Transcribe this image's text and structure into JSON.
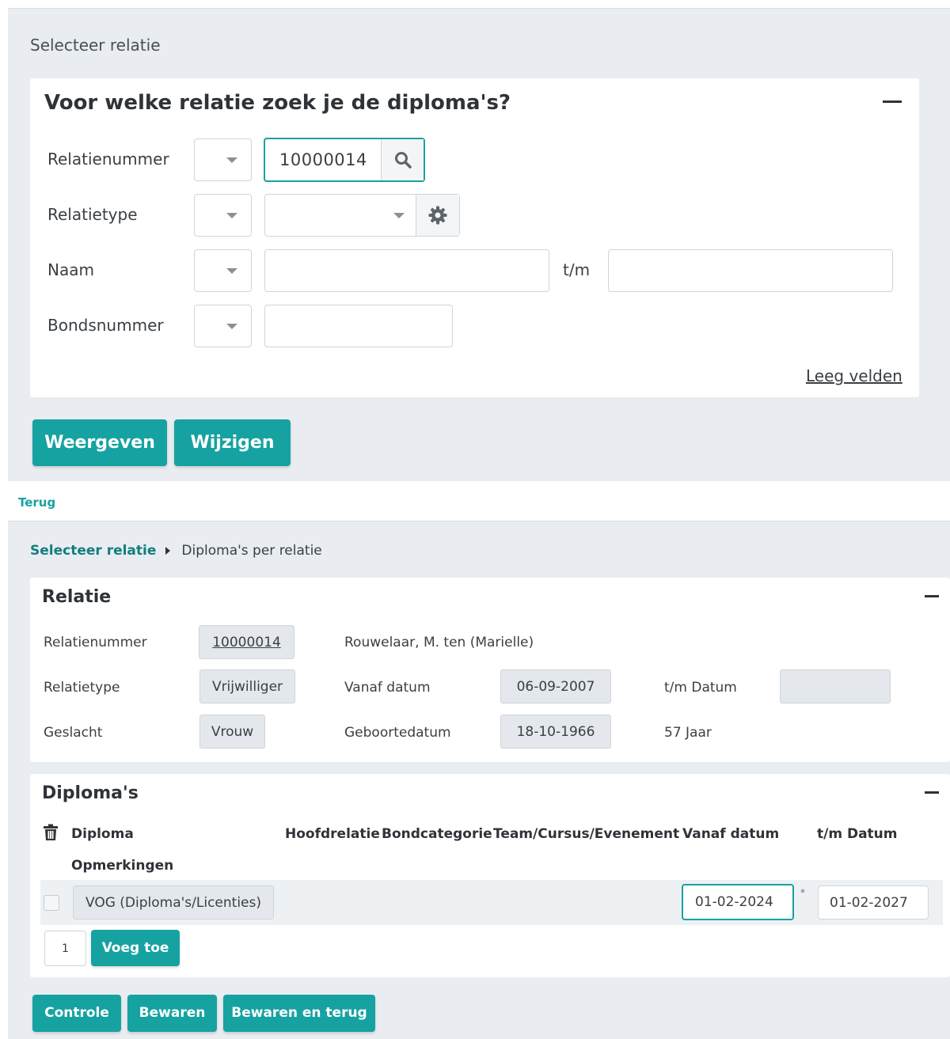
{
  "top": {
    "section_title": "Selecteer relatie",
    "card_title": "Voor welke relatie zoek je de diploma's?",
    "fields": {
      "relatienummer": {
        "label": "Relatienummer",
        "value": "10000014"
      },
      "relatietype": {
        "label": "Relatietype",
        "value": ""
      },
      "naam": {
        "label": "Naam",
        "separator": "t/m",
        "from": "",
        "to": ""
      },
      "bondsnummer": {
        "label": "Bondsnummer",
        "value": ""
      }
    },
    "clear_link": "Leeg velden",
    "buttons": {
      "show": "Weergeven",
      "edit": "Wijzigen"
    }
  },
  "back_link": "Terug",
  "breadcrumb": {
    "root": "Selecteer relatie",
    "current": "Diploma's per relatie"
  },
  "relatie": {
    "title": "Relatie",
    "relatienummer_label": "Relatienummer",
    "relatienummer": "10000014",
    "name": "Rouwelaar, M. ten (Marielle)",
    "relatietype_label": "Relatietype",
    "relatietype": "Vrijwilliger",
    "vanaf_label": "Vanaf datum",
    "vanaf": "06-09-2007",
    "tm_label": "t/m Datum",
    "tm": "",
    "geslacht_label": "Geslacht",
    "geslacht": "Vrouw",
    "geboorte_label": "Geboortedatum",
    "geboorte": "18-10-1966",
    "age": "57 Jaar"
  },
  "diplomas": {
    "title": "Diploma's",
    "columns": [
      "Diploma",
      "Hoofdrelatie",
      "Bondcategorie",
      "Team/Cursus/Evenement",
      "Vanaf datum",
      "t/m Datum",
      "Opmerkingen"
    ],
    "rows": [
      {
        "diploma": "VOG (Diploma's/Licenties)",
        "vanaf": "01-02-2024",
        "required": "*",
        "tm": "01-02-2027"
      }
    ],
    "add_count": "1",
    "add_button": "Voeg toe"
  },
  "footer_buttons": {
    "check": "Controle",
    "save": "Bewaren",
    "save_back": "Bewaren en terug"
  },
  "colors": {
    "accent": "#17a2a2",
    "panel_bg": "#e9edf1"
  }
}
